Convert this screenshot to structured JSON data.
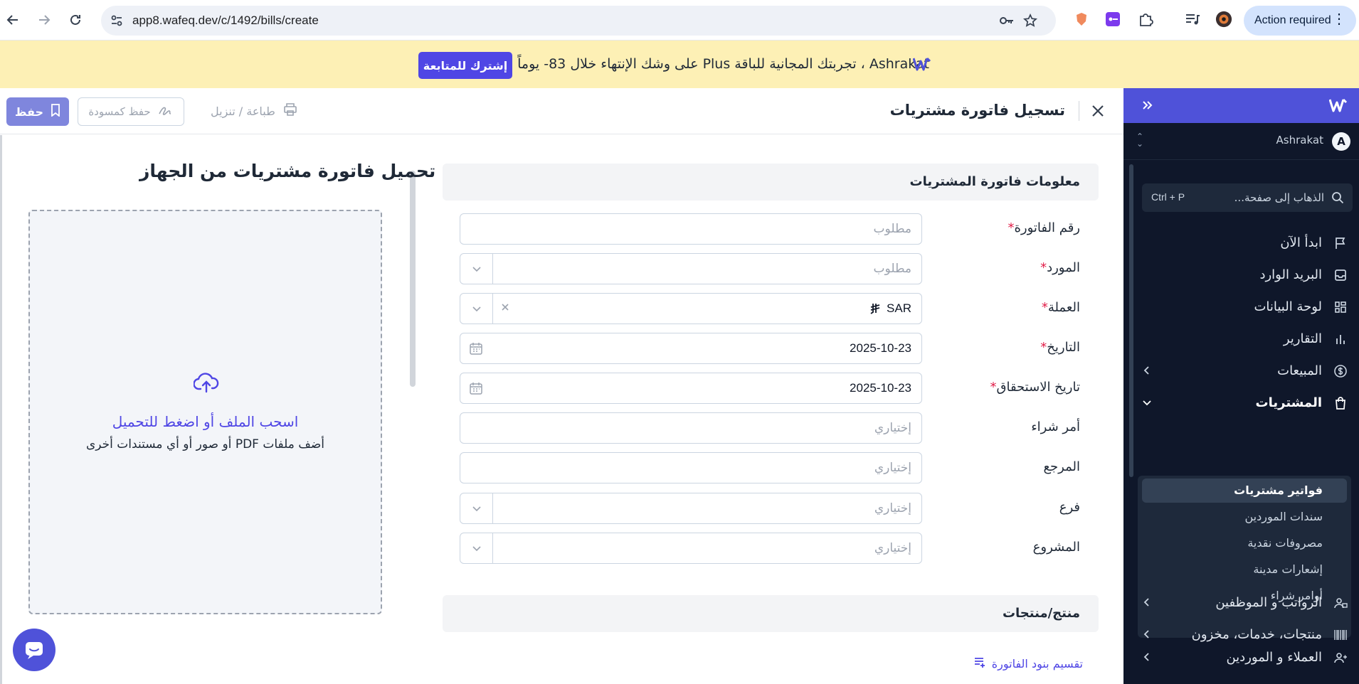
{
  "browser": {
    "url": "app8.wafeq.dev/c/1492/bills/create",
    "action_required": "Action required"
  },
  "banner": {
    "message": "Ashrakat ، تجربتك المجانية للباقة Plus على وشك الإنتهاء خلال 83- يوماً",
    "cta": "إشترك للمتابعة"
  },
  "sidebar": {
    "user_name": "Ashrakat",
    "avatar_letter": "A",
    "search_placeholder": "الذهاب إلى صفحة...",
    "search_shortcut": "Ctrl + P",
    "items": [
      {
        "label": "ابدأ الآن"
      },
      {
        "label": "البريد الوارد"
      },
      {
        "label": "لوحة البيانات"
      },
      {
        "label": "التقارير"
      },
      {
        "label": "المبيعات"
      },
      {
        "label": "المشتريات"
      },
      {
        "label": "العملاء و الموردين"
      },
      {
        "label": "الرواتب و الموظفين"
      },
      {
        "label": "منتجات، خدمات، مخزون"
      }
    ],
    "purchases_sub": [
      {
        "label": "فواتير مشتريات"
      },
      {
        "label": "سندات الموردين"
      },
      {
        "label": "مصروفات نقدية"
      },
      {
        "label": "إشعارات مدينة"
      },
      {
        "label": "أوامر شراء"
      }
    ]
  },
  "header": {
    "title": "تسجيل فاتورة مشتريات",
    "save": "حفظ",
    "save_draft": "حفظ كمسودة",
    "print": "طباعة / تنزيل"
  },
  "form": {
    "section_title": "معلومات فاتورة المشتريات",
    "fields": [
      {
        "label": "رقم الفاتورة",
        "value": "مطلوب"
      },
      {
        "label": "المورد",
        "value": "مطلوب"
      },
      {
        "label": "العملة",
        "value": "SAR"
      },
      {
        "label": "التاريخ",
        "value": "2025-10-23"
      },
      {
        "label": "تاريخ الاستحقاق",
        "value": "2025-10-23"
      },
      {
        "label": "أمر شراء",
        "value": "إختياري"
      },
      {
        "label": "المرجع",
        "value": "إختياري"
      },
      {
        "label": "فرع",
        "value": "إختياري"
      },
      {
        "label": "المشروع",
        "value": "إختياري"
      }
    ],
    "required_mark": "*",
    "products_title": "منتج/منتجات",
    "split_lines": "تقسيم بنود الفاتورة"
  },
  "upload": {
    "title": "تحميل فاتورة مشتريات من الجهاز",
    "main": "اسحب الملف أو اضغط للتحميل",
    "sub": "أضف ملفات PDF أو صور أو أي مستندات أخرى"
  },
  "colors": {
    "accent": "#4f46e5",
    "sidebar_bg": "#0f172a",
    "banner_bg": "#fdf0b5",
    "required": "#e11d48"
  }
}
